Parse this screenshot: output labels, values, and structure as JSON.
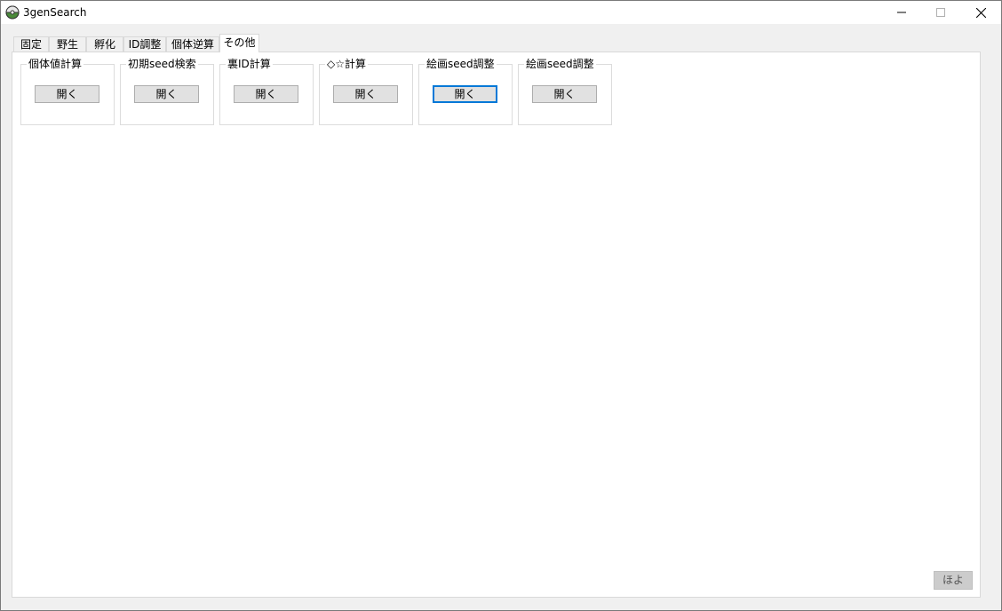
{
  "window": {
    "title": "3genSearch",
    "icon": "pokeball-app-icon"
  },
  "tabs": [
    {
      "label": "固定",
      "active": false
    },
    {
      "label": "野生",
      "active": false
    },
    {
      "label": "孵化",
      "active": false
    },
    {
      "label": "ID調整",
      "active": false
    },
    {
      "label": "個体逆算",
      "active": false
    },
    {
      "label": "その他",
      "active": true
    }
  ],
  "groups": [
    {
      "title": "個体値計算",
      "button_label": "開く",
      "focused": false
    },
    {
      "title": "初期seed検索",
      "button_label": "開く",
      "focused": false
    },
    {
      "title": "裏ID計算",
      "button_label": "開く",
      "focused": false
    },
    {
      "title": "◇☆計算",
      "button_label": "開く",
      "focused": false
    },
    {
      "title": "絵画seed調整",
      "button_label": "開く",
      "focused": true
    },
    {
      "title": "絵画seed調整",
      "button_label": "開く",
      "focused": false
    }
  ],
  "footer": {
    "button_label": "ほよ"
  }
}
